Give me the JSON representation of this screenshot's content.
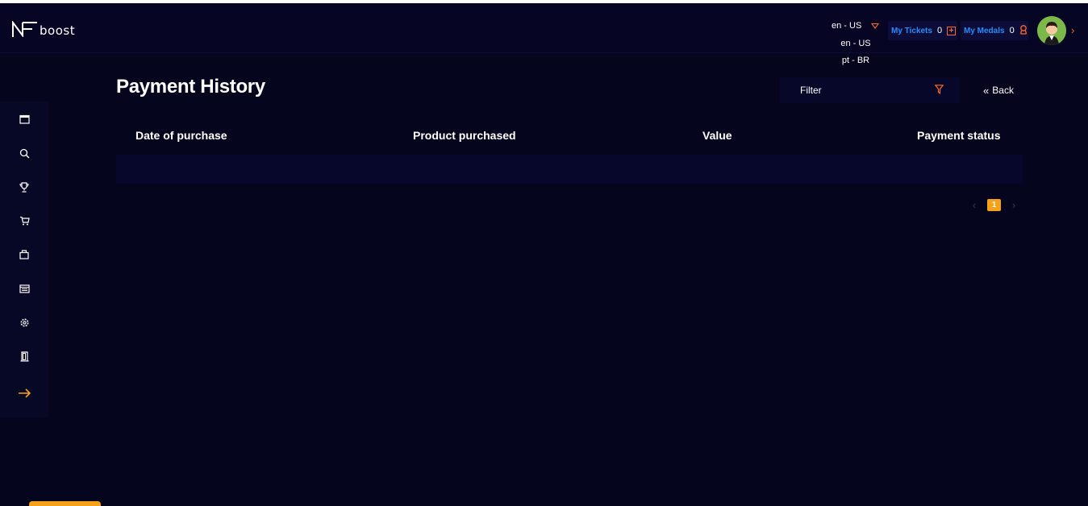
{
  "header": {
    "logo_text": "boost",
    "language": {
      "current": "en - US",
      "options": [
        "en - US",
        "pt - BR"
      ]
    },
    "tickets": {
      "label": "My Tickets",
      "count": "0"
    },
    "medals": {
      "label": "My Medals",
      "count": "0"
    }
  },
  "sidebar": {
    "items": [
      {
        "icon": "calendar-icon"
      },
      {
        "icon": "search-icon"
      },
      {
        "icon": "trophy-icon"
      },
      {
        "icon": "cart-icon"
      },
      {
        "icon": "bag-icon"
      },
      {
        "icon": "table-icon"
      },
      {
        "icon": "gear-icon"
      },
      {
        "icon": "door-icon"
      },
      {
        "icon": "arrow-right-icon"
      }
    ]
  },
  "main": {
    "title": "Payment History",
    "filter_placeholder": "Filter",
    "back_label": "Back",
    "table": {
      "columns": [
        "Date of purchase",
        "Product purchased",
        "Value",
        "Payment status"
      ],
      "rows": []
    },
    "pagination": {
      "current_page": "1"
    }
  },
  "colors": {
    "background": "#05051e",
    "accent_orange": "#ff6a2b",
    "page_badge": "#f5a21a",
    "link_blue": "#2a8cff"
  }
}
